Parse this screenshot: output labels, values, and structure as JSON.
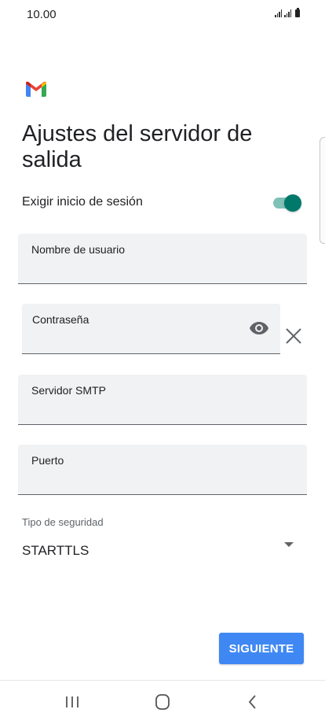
{
  "status_bar": {
    "time": "10.00"
  },
  "app": {
    "logo_icon": "gmail-logo-icon",
    "colors": {
      "accent_toggle": "#00796b",
      "button": "#3f88f4",
      "field_background": "#f1f2f3"
    }
  },
  "page": {
    "title": "Ajustes del servidor de salida"
  },
  "require_signin": {
    "label": "Exigir inicio de sesión",
    "enabled": true
  },
  "fields": {
    "username": {
      "label": "Nombre de usuario",
      "value": ""
    },
    "password": {
      "label": "Contraseña",
      "value": ""
    },
    "smtp_server": {
      "label": "Servidor SMTP",
      "value": ""
    },
    "port": {
      "label": "Puerto",
      "value": ""
    }
  },
  "security": {
    "label": "Tipo de seguridad",
    "value": "STARTTLS"
  },
  "actions": {
    "next_label": "SIGUIENTE"
  },
  "nav_bar": {
    "icons": [
      "recent-apps-icon",
      "home-icon",
      "back-icon"
    ]
  }
}
